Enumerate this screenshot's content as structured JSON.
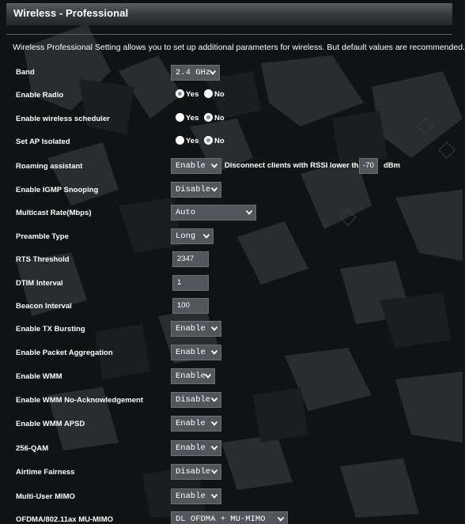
{
  "header": {
    "title": "Wireless - Professional",
    "description": "Wireless Professional Setting allows you to set up additional parameters for wireless. But default values are recommended."
  },
  "settings": {
    "band": {
      "label": "Band",
      "value": "2.4 GHz"
    },
    "enable_radio": {
      "label": "Enable Radio",
      "yes": "Yes",
      "no": "No",
      "selected": "Yes"
    },
    "wireless_scheduler": {
      "label": "Enable wireless scheduler",
      "yes": "Yes",
      "no": "No",
      "selected": "No"
    },
    "ap_isolated": {
      "label": "Set AP Isolated",
      "yes": "Yes",
      "no": "No",
      "selected": "No"
    },
    "roaming_assistant": {
      "label": "Roaming assistant",
      "value": "Enable",
      "rssi_text": "Disconnect clients with RSSI lower than :",
      "rssi_value": "-70",
      "unit": "dBm"
    },
    "igmp_snooping": {
      "label": "Enable IGMP Snooping",
      "value": "Disable"
    },
    "multicast_rate": {
      "label": "Multicast Rate(Mbps)",
      "value": "Auto"
    },
    "preamble_type": {
      "label": "Preamble Type",
      "value": "Long"
    },
    "rts_threshold": {
      "label": "RTS Threshold",
      "value": "2347"
    },
    "dtim_interval": {
      "label": "DTIM Interval",
      "value": "1"
    },
    "beacon_interval": {
      "label": "Beacon Interval",
      "value": "100"
    },
    "tx_bursting": {
      "label": "Enable TX Bursting",
      "value": "Enable"
    },
    "packet_aggregation": {
      "label": "Enable Packet Aggregation",
      "value": "Enable"
    },
    "wmm": {
      "label": "Enable WMM",
      "value": "Enable"
    },
    "wmm_no_ack": {
      "label": "Enable WMM No-Acknowledgement",
      "value": "Disable"
    },
    "wmm_apsd": {
      "label": "Enable WMM APSD",
      "value": "Enable"
    },
    "qam256": {
      "label": "256-QAM",
      "value": "Enable"
    },
    "airtime_fairness": {
      "label": "Airtime Fairness",
      "value": "Disable"
    },
    "mu_mimo": {
      "label": "Multi-User MIMO",
      "value": "Enable"
    },
    "ofdma": {
      "label": "OFDMA/802.11ax MU-MIMO",
      "value": "DL OFDMA + MU-MIMO"
    }
  },
  "colors": {
    "background": "#101112",
    "field_bg": "#52565a",
    "text": "#ffffff"
  }
}
